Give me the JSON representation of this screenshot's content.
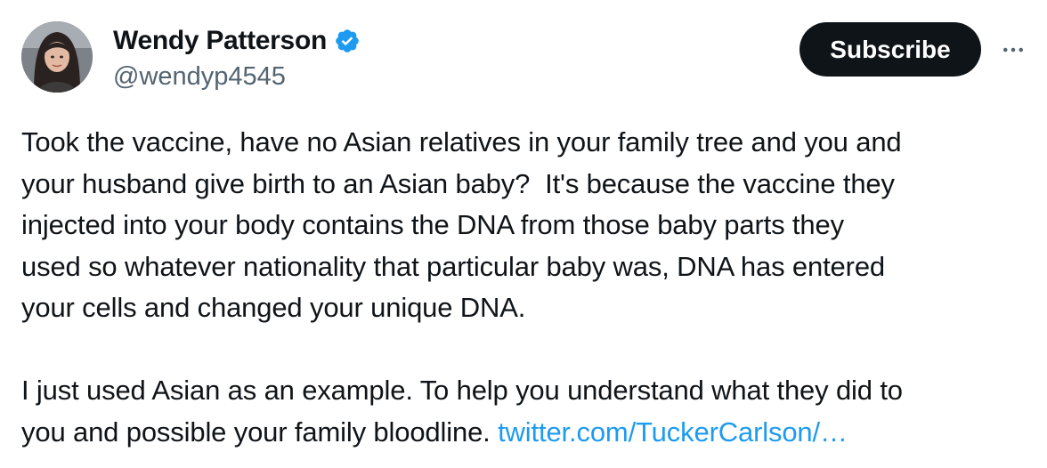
{
  "author": {
    "display_name": "Wendy Patterson",
    "handle": "@wendyp4545",
    "verified": true,
    "verified_badge_color": "#1d9bf0"
  },
  "actions": {
    "subscribe_label": "Subscribe",
    "more_label": "⋯"
  },
  "tweet": {
    "paragraph1_lines": [
      "Took the vaccine, have no Asian relatives in your family tree and you and",
      "your husband give birth to an Asian baby?  It's because the vaccine they",
      "injected into your body contains the DNA from those baby parts they",
      "used so whatever nationality that particular baby was, DNA has entered",
      "your cells and changed your unique DNA."
    ],
    "paragraph2_lines": [
      "I just used Asian as an example. To help you understand what they did to"
    ],
    "paragraph2_last_line_text": "you and possible your family bloodline. ",
    "link_text": "twitter.com/TuckerCarlson/…"
  },
  "colors": {
    "text": "#0f1419",
    "secondary_text": "#536471",
    "link": "#1d9bf0",
    "button_bg": "#0f1419",
    "button_text": "#ffffff"
  }
}
